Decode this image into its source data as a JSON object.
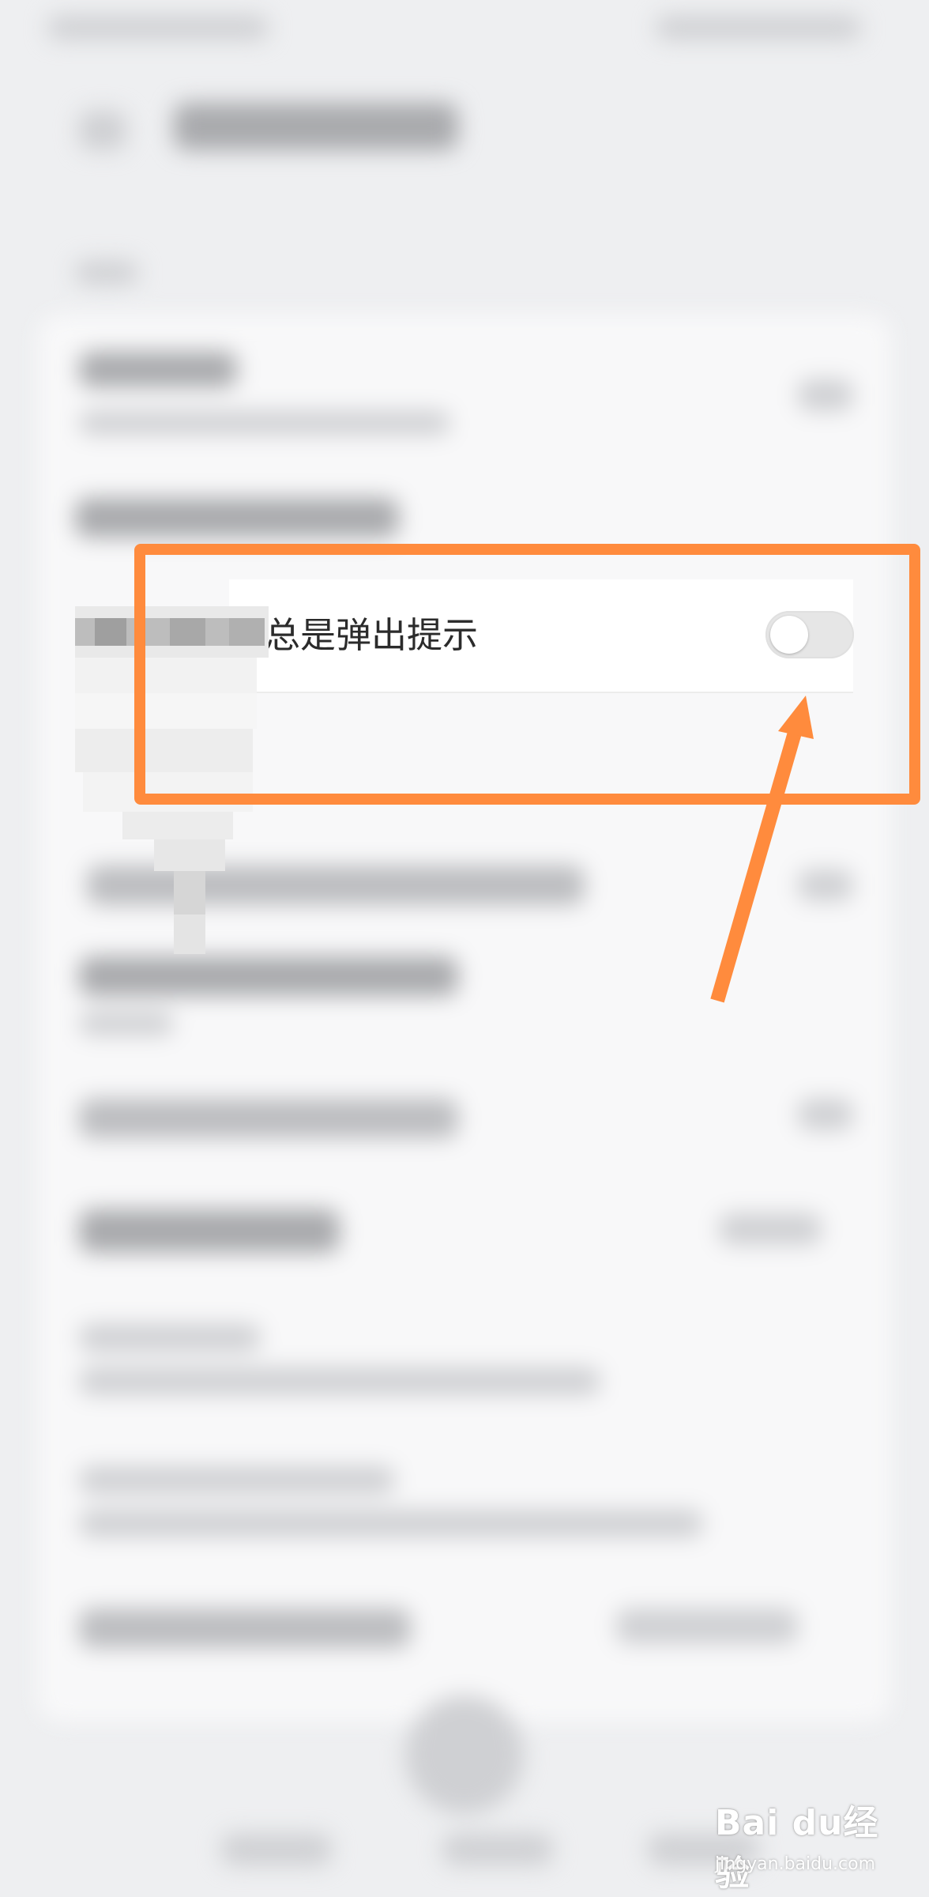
{
  "setting": {
    "label": "总是弹出提示",
    "toggle_on": false
  },
  "colors": {
    "annotation": "#ff8b3d",
    "background": "#eeeff1"
  },
  "watermark": {
    "brand": "Bai du经验",
    "url": "jingyan.baidu.com"
  }
}
